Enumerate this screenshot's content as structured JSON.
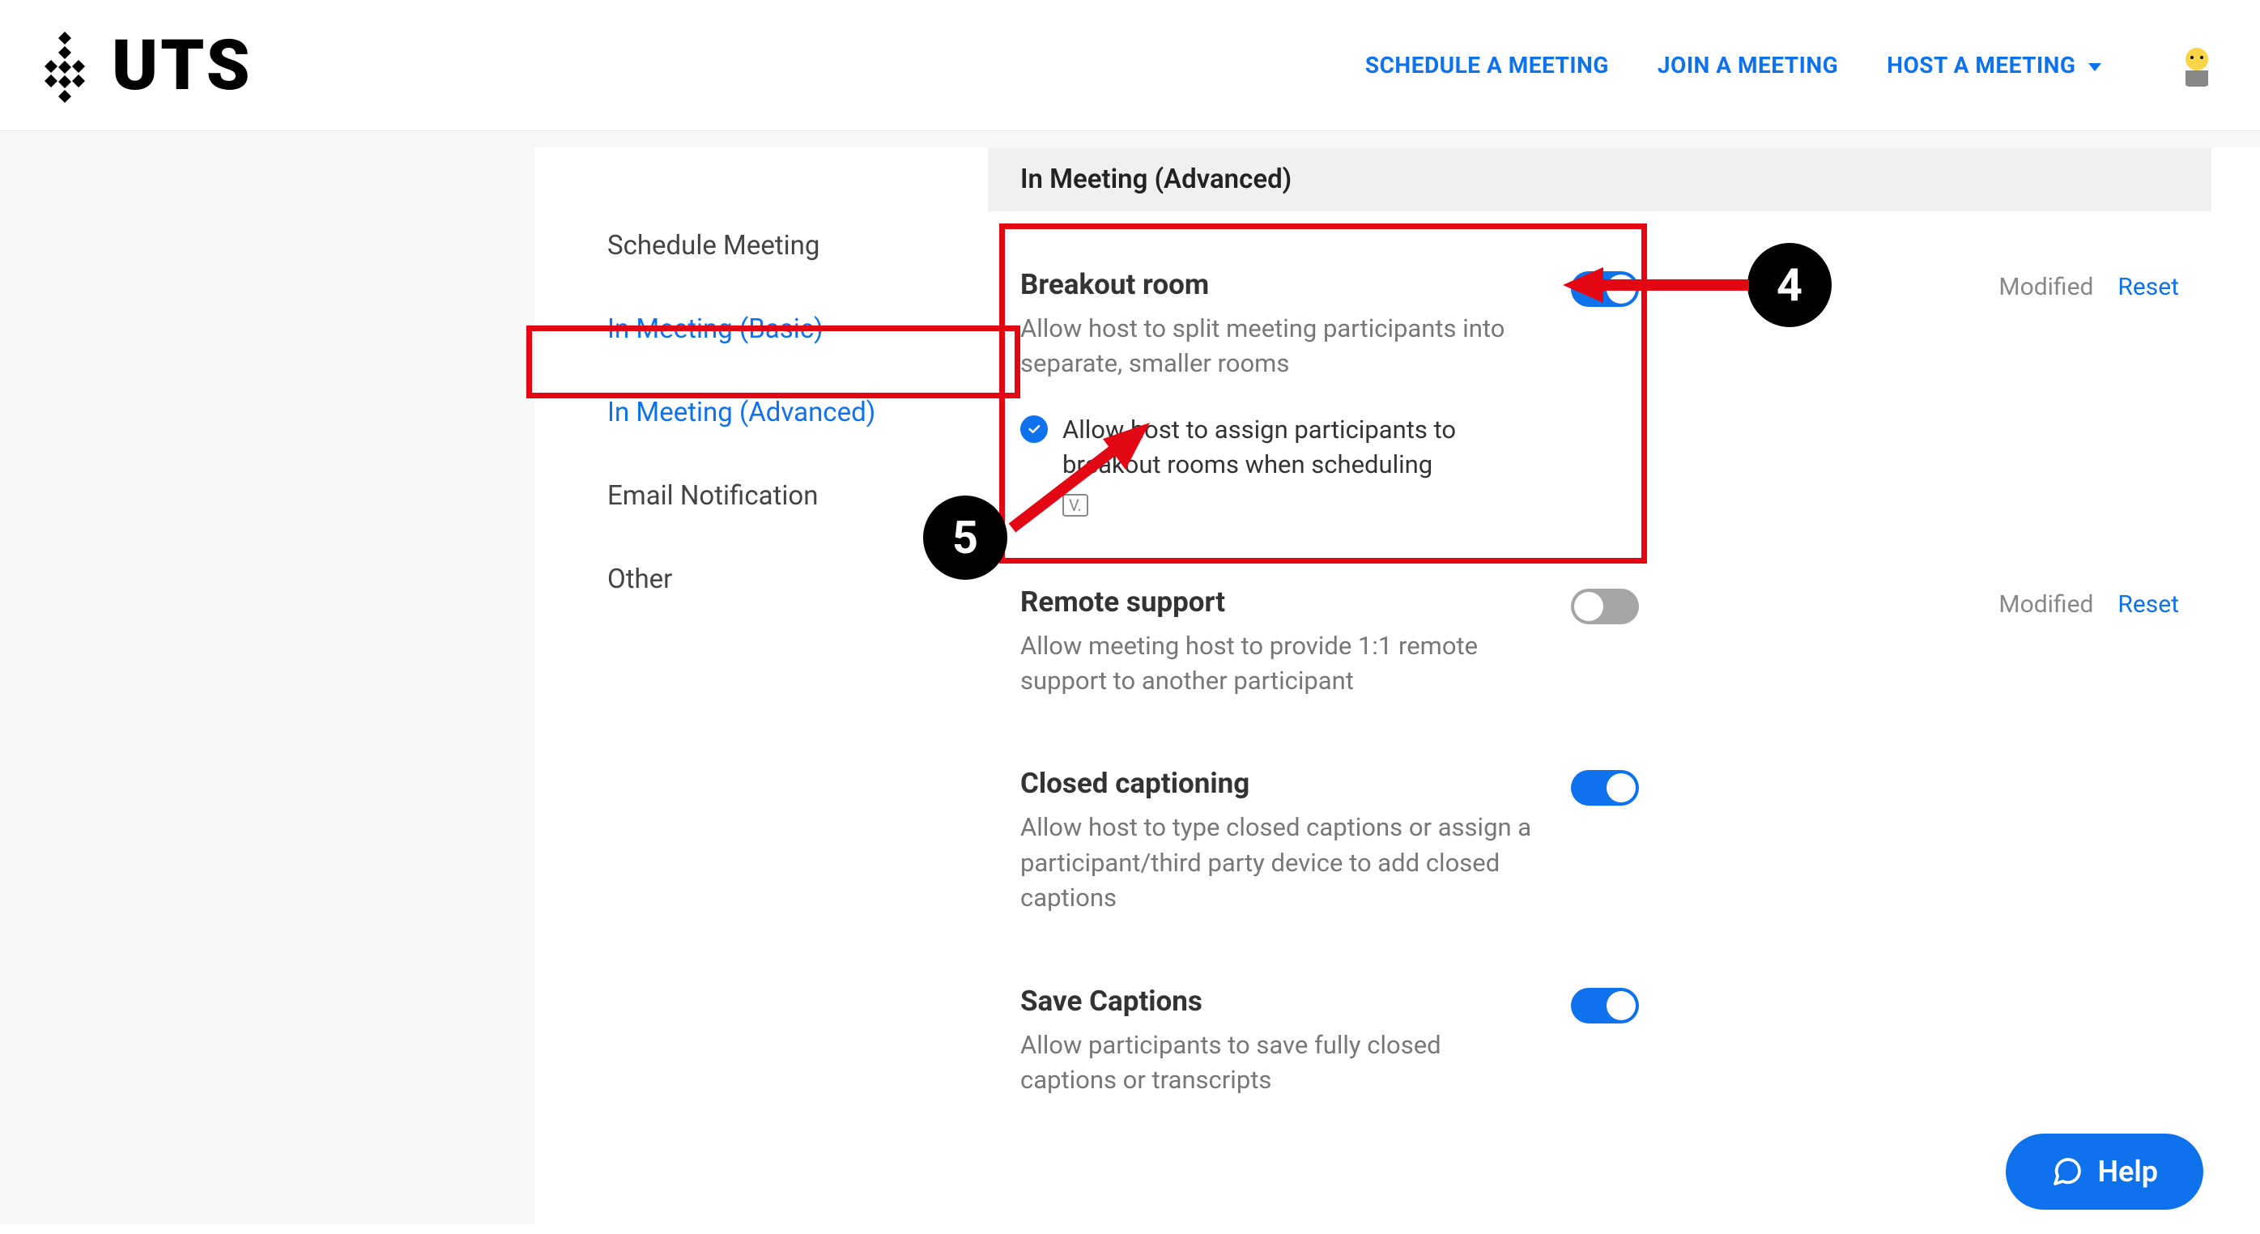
{
  "header": {
    "logo_text": "UTS",
    "nav": {
      "schedule": "SCHEDULE A MEETING",
      "join": "JOIN A MEETING",
      "host": "HOST A MEETING"
    }
  },
  "side_nav": {
    "items": [
      {
        "label": "Schedule Meeting",
        "active": false
      },
      {
        "label": "In Meeting (Basic)",
        "active": true
      },
      {
        "label": "In Meeting (Advanced)",
        "active": true
      },
      {
        "label": "Email Notification",
        "active": false
      },
      {
        "label": "Other",
        "active": false
      }
    ]
  },
  "section_header": "In Meeting (Advanced)",
  "settings": [
    {
      "title": "Breakout room",
      "desc": "Allow host to split meeting participants into separate, smaller rooms",
      "toggle_on": true,
      "modified": true,
      "sub_option": "Allow host to assign participants to breakout rooms when scheduling",
      "sub_checked": true
    },
    {
      "title": "Remote support",
      "desc": "Allow meeting host to provide 1:1 remote support to another participant",
      "toggle_on": false,
      "modified": true
    },
    {
      "title": "Closed captioning",
      "desc": "Allow host to type closed captions or assign a participant/third party device to add closed captions",
      "toggle_on": true,
      "modified": false
    },
    {
      "title": "Save Captions",
      "desc": "Allow participants to save fully closed captions or transcripts",
      "toggle_on": true,
      "modified": false
    }
  ],
  "labels": {
    "modified": "Modified",
    "reset": "Reset",
    "help": "Help"
  },
  "annotations": {
    "badge4": "4",
    "badge5": "5"
  }
}
